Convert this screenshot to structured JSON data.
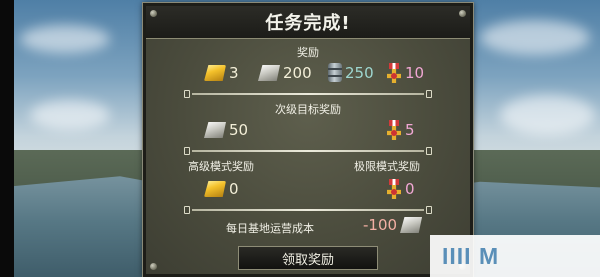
{
  "dialog": {
    "title": "任务完成!",
    "rewards_label": "奖励",
    "rewards": {
      "gold": "3",
      "silver": "200",
      "fuel": "250",
      "medals": "10"
    },
    "secondary_label": "次级目标奖励",
    "secondary": {
      "silver": "50",
      "medals": "5"
    },
    "advanced_label": "高级模式奖励",
    "advanced_gold": "0",
    "extreme_label": "极限模式奖励",
    "extreme_medals": "0",
    "daily_cost_label": "每日基地运营成本",
    "daily_cost_value": "-100",
    "claim_button": "领取奖励"
  },
  "watermark": "IIII     M",
  "colors": {
    "gold": "#f4c12b",
    "silver": "#c9c9c2",
    "fuel_text": "#9ed7d0",
    "medal_text": "#f1a7d4",
    "panel": "#4b4c3d"
  },
  "icons": [
    "gold-bar-icon",
    "silver-bar-icon",
    "fuel-barrel-icon",
    "medal-icon"
  ]
}
